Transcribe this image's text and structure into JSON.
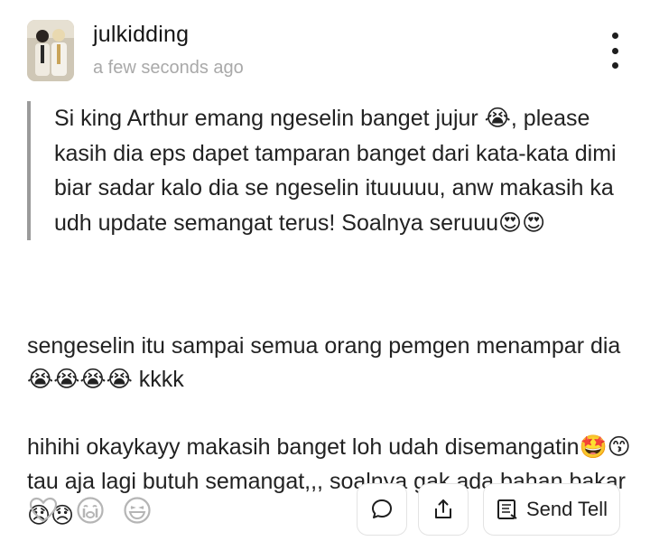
{
  "post": {
    "username": "julkidding",
    "timestamp": "a few seconds ago",
    "quote_text": "Si king Arthur emang ngeselin banget jujur 😭, please kasih dia eps dapet tamparan banget dari kata-kata dimi biar sadar kalo dia se ngeselin ituuuuu, anw makasih ka udh update semangat terus! Soalnya seruuu😍😍",
    "reply_lines": [
      "sengeselin itu sampai semua orang pemgen menampar dia😭😭😭😭 kkkk",
      "hihihi okaykayy makasih banget loh udah disemangatin🤩😙 tau aja lagi butuh semangat,,, soalnya gak ada bahan bakar😞😞"
    ]
  },
  "actions": {
    "send_tell_label": "Send Tell"
  },
  "icons": {
    "more": "more-vertical-icon",
    "like": "heart-icon",
    "cry": "crying-face-icon",
    "laugh": "laughing-face-icon",
    "comment": "comment-bubble-icon",
    "share": "share-icon",
    "tell": "scroll-icon"
  },
  "colors": {
    "quote_border": "#9b9b9b",
    "timestamp": "#a9a9a9",
    "icon_gray": "#b5b5b5"
  }
}
